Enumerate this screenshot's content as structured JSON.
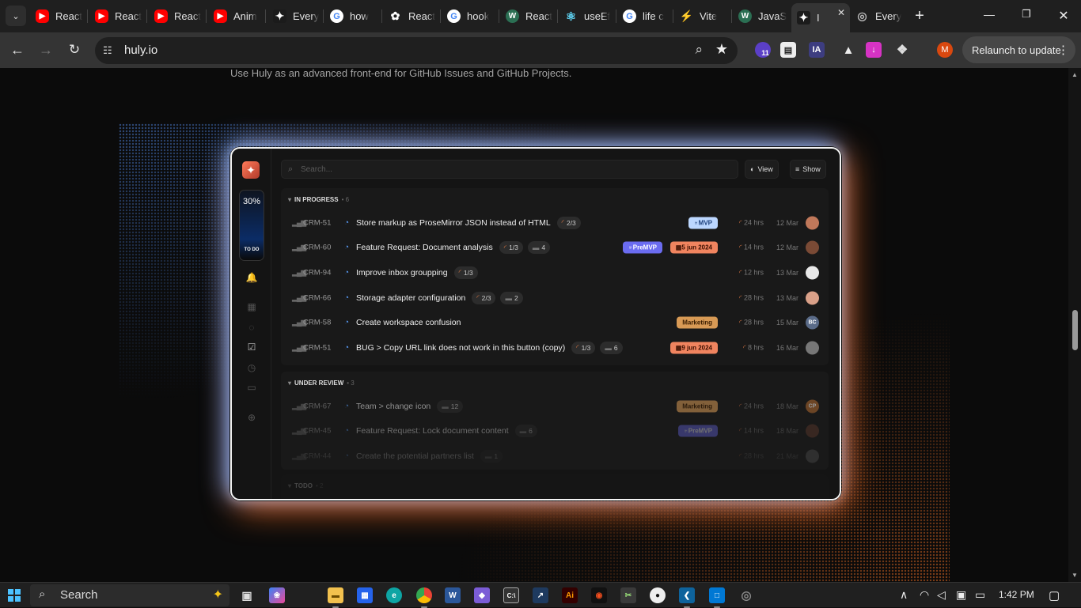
{
  "browser": {
    "tabs": [
      {
        "title": "React",
        "icon": "youtube-icon",
        "kind": "yt"
      },
      {
        "title": "React",
        "icon": "youtube-icon",
        "kind": "yt"
      },
      {
        "title": "React",
        "icon": "youtube-icon",
        "kind": "yt"
      },
      {
        "title": "Anim",
        "icon": "youtube-icon",
        "kind": "yt"
      },
      {
        "title": "Every",
        "icon": "huly-icon",
        "kind": "huly"
      },
      {
        "title": "how",
        "icon": "google-icon",
        "kind": "g"
      },
      {
        "title": "React",
        "icon": "openai-icon",
        "kind": "oai"
      },
      {
        "title": "hook",
        "icon": "google-icon",
        "kind": "g"
      },
      {
        "title": "React",
        "icon": "w3-icon",
        "kind": "w"
      },
      {
        "title": "useEf",
        "icon": "react-icon",
        "kind": "react"
      },
      {
        "title": "life c",
        "icon": "google-icon",
        "kind": "g"
      },
      {
        "title": "Vite",
        "icon": "vite-icon",
        "kind": "vite"
      },
      {
        "title": "JavaS",
        "icon": "w3-icon",
        "kind": "w"
      },
      {
        "title": "I",
        "icon": "huly-icon",
        "kind": "huly",
        "active": true
      },
      {
        "title": "Every",
        "icon": "globe-icon",
        "kind": "globe"
      }
    ],
    "url": "huly.io",
    "relaunch_label": "Relaunch to update",
    "profile_initial": "M",
    "ext_badge": "11",
    "ext_ia": "IA"
  },
  "page": {
    "lede": "Use Huly as an advanced front-end for GitHub Issues and GitHub Projects."
  },
  "app": {
    "todo_percent": "30%",
    "todo_label": "TO DO",
    "search_placeholder": "Search...",
    "view_label": "View",
    "show_label": "Show",
    "groups": [
      {
        "name": "IN PROGRESS",
        "count": "6",
        "rows": [
          {
            "id": "CRM-51",
            "title": "Store markup as ProseMirror JSON instead of HTML",
            "sub": "2/3",
            "comments": "",
            "tag": "MVP",
            "tagkind": "mvp",
            "due": "",
            "est": "24 hrs",
            "date": "12 Mar",
            "avatar": "#c0785a",
            "avtext": "",
            "fade": ""
          },
          {
            "id": "CRM-60",
            "title": "Feature Request: Document analysis",
            "sub": "1/3",
            "comments": "4",
            "tag": "PreMVP",
            "tagkind": "premvp",
            "due": "5 jun 2024",
            "est": "14 hrs",
            "date": "12 Mar",
            "avatar": "#7a4a35",
            "avtext": "",
            "fade": ""
          },
          {
            "id": "CRM-94",
            "title": "Improve inbox groupping",
            "sub": "1/3",
            "comments": "",
            "tag": "",
            "tagkind": "",
            "due": "",
            "est": "12 hrs",
            "date": "13 Mar",
            "avatar": "#e8e8e8",
            "avtext": "",
            "fade": ""
          },
          {
            "id": "CRM-66",
            "title": "Storage adapter configuration",
            "sub": "2/3",
            "comments": "2",
            "tag": "",
            "tagkind": "",
            "due": "",
            "est": "28 hrs",
            "date": "13 Mar",
            "avatar": "#d9a088",
            "avtext": "",
            "fade": ""
          },
          {
            "id": "CRM-58",
            "title": "Create workspace confusion",
            "sub": "",
            "comments": "",
            "tag": "Marketing",
            "tagkind": "mkt",
            "due": "",
            "est": "28 hrs",
            "date": "15 Mar",
            "avatar": "#5a6b88",
            "avtext": "BC",
            "fade": ""
          },
          {
            "id": "CRM-51",
            "title": "BUG > Copy URL link does not work in this button (copy)",
            "sub": "1/3",
            "comments": "6",
            "tag": "",
            "tagkind": "",
            "due": "9 jun 2024",
            "est": "8 hrs",
            "date": "16 Mar",
            "avatar": "#777",
            "avtext": "",
            "fade": ""
          }
        ]
      },
      {
        "name": "UNDER REVIEW",
        "count": "3",
        "rows": [
          {
            "id": "CRM-67",
            "title": "Team > change icon",
            "sub": "",
            "comments": "12",
            "tag": "Marketing",
            "tagkind": "mkt",
            "due": "",
            "est": "24 hrs",
            "date": "18 Mar",
            "avatar": "#b06a30",
            "avtext": "CP",
            "fade": "fade1"
          },
          {
            "id": "CRM-45",
            "title": "Feature Request: Lock document content",
            "sub": "",
            "comments": "6",
            "tag": "PreMVP",
            "tagkind": "premvp",
            "due": "",
            "est": "14 hrs",
            "date": "18 Mar",
            "avatar": "#6a4030",
            "avtext": "",
            "fade": "fade2"
          },
          {
            "id": "CRM-44",
            "title": "Create the potential partners list",
            "sub": "",
            "comments": "1",
            "tag": "",
            "tagkind": "",
            "due": "",
            "est": "28 hrs",
            "date": "21 Mar",
            "avatar": "#888",
            "avtext": "",
            "fade": "fade3"
          }
        ]
      },
      {
        "name": "TODO",
        "count": "2",
        "rows": []
      }
    ]
  },
  "taskbar": {
    "search_label": "Search",
    "time": "1:42 PM"
  }
}
